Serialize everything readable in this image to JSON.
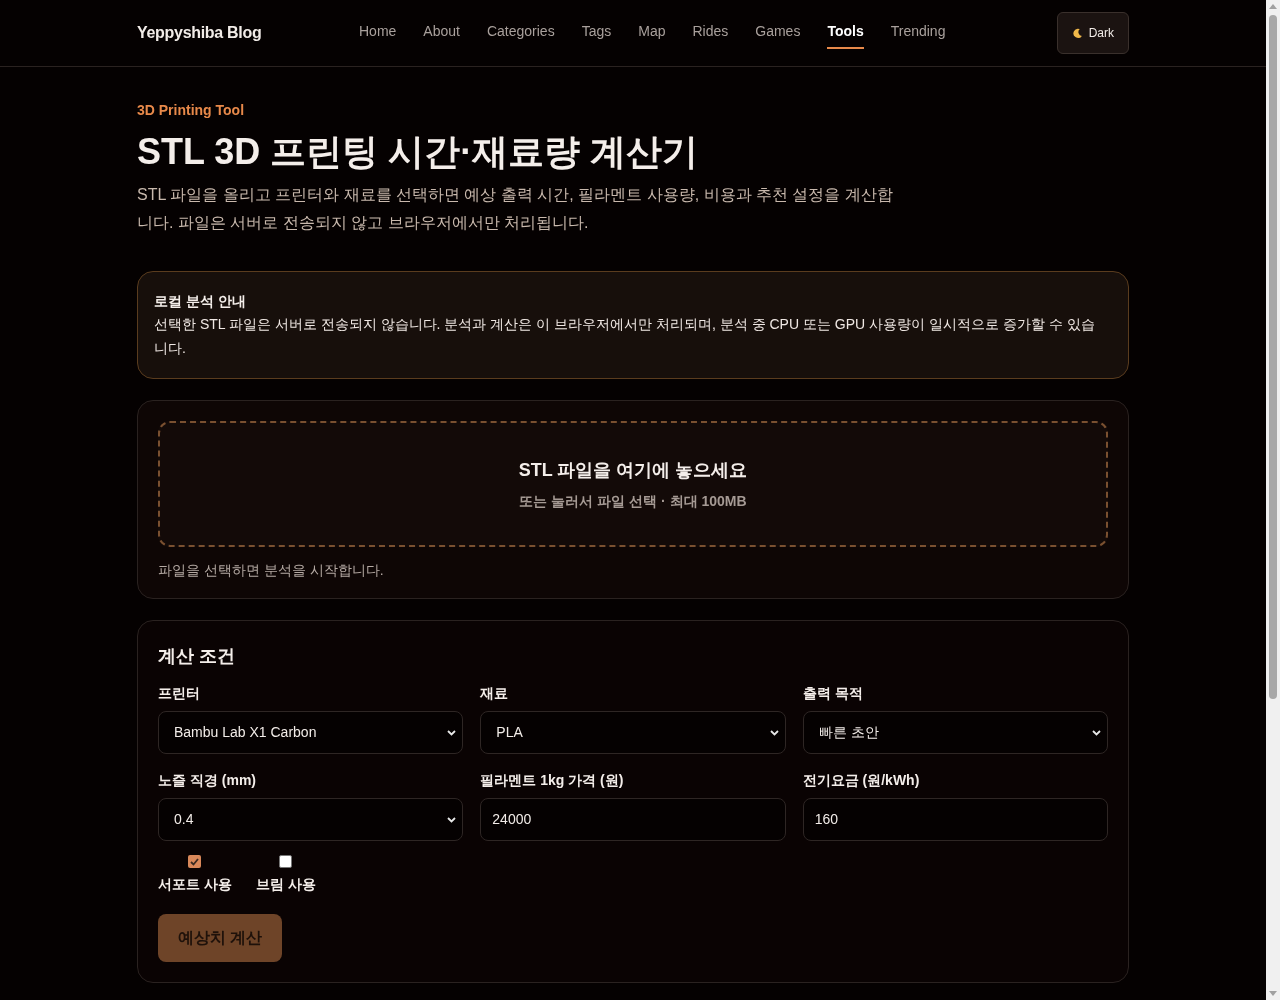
{
  "header": {
    "brand": "Yeppyshiba Blog",
    "nav": [
      {
        "label": "Home",
        "selected": false
      },
      {
        "label": "About",
        "selected": false
      },
      {
        "label": "Categories",
        "selected": false
      },
      {
        "label": "Tags",
        "selected": false
      },
      {
        "label": "Map",
        "selected": false
      },
      {
        "label": "Rides",
        "selected": false
      },
      {
        "label": "Games",
        "selected": false
      },
      {
        "label": "Tools",
        "selected": true
      },
      {
        "label": "Trending",
        "selected": false
      }
    ],
    "theme_button": {
      "label": "Dark"
    }
  },
  "hero": {
    "eyebrow": "3D Printing Tool",
    "title": "STL 3D 프린팅 시간·재료량 계산기",
    "description": "STL 파일을 올리고 프린터와 재료를 선택하면 예상 출력 시간, 필라멘트 사용량, 비용과 추천 설정을 계산합니다. 파일은 서버로 전송되지 않고 브라우저에서만 처리됩니다."
  },
  "notice": {
    "title": "로컬 분석 안내",
    "text": "선택한 STL 파일은 서버로 전송되지 않습니다. 분석과 계산은 이 브라우저에서만 처리되며, 분석 중 CPU 또는 GPU 사용량이 일시적으로 증가할 수 있습니다."
  },
  "upload": {
    "title": "STL 파일을 여기에 놓으세요",
    "hint": "또는 눌러서 파일 선택 · 최대 100MB",
    "status": "파일을 선택하면 분석을 시작합니다."
  },
  "form": {
    "title": "계산 조건",
    "fields": [
      {
        "kind": "select",
        "label": "프린터",
        "value": "Bambu Lab X1 Carbon"
      },
      {
        "kind": "select",
        "label": "재료",
        "value": "PLA"
      },
      {
        "kind": "select",
        "label": "출력 목적",
        "value": "빠른 초안"
      },
      {
        "kind": "select",
        "label": "노즐 직경 (mm)",
        "value": "0.4"
      },
      {
        "kind": "input",
        "label": "필라멘트 1kg 가격 (원)",
        "value": "24000"
      },
      {
        "kind": "input",
        "label": "전기요금 (원/kWh)",
        "value": "160"
      }
    ],
    "checkboxes": [
      {
        "label": "서포트 사용",
        "checked": true
      },
      {
        "label": "브림 사용",
        "checked": false
      }
    ],
    "submit": "예상치 계산"
  }
}
